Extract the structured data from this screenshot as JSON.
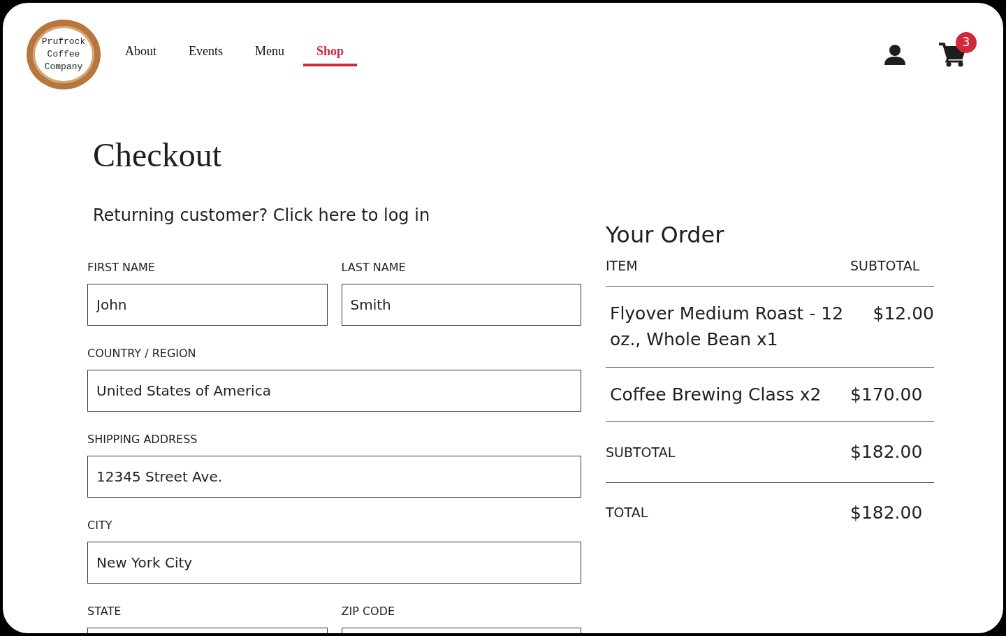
{
  "logo": {
    "lines": [
      "Prufrock",
      "Coffee",
      "Company"
    ]
  },
  "nav": [
    {
      "label": "About",
      "selected": false
    },
    {
      "label": "Events",
      "selected": false
    },
    {
      "label": "Menu",
      "selected": false
    },
    {
      "label": "Shop",
      "selected": true
    }
  ],
  "cart": {
    "count": "3"
  },
  "page_title": "Checkout",
  "login_prompt": "Returning customer? Click here to log in",
  "form": {
    "rows": [
      [
        {
          "label": "FIRST NAME",
          "value": "John"
        },
        {
          "label": "LAST NAME",
          "value": "Smith"
        }
      ],
      [
        {
          "label": "COUNTRY / REGION",
          "value": "United States of America"
        }
      ],
      [
        {
          "label": "SHIPPING ADDRESS",
          "value": "12345 Street Ave."
        }
      ],
      [
        {
          "label": "CITY",
          "value": "New York City"
        }
      ],
      [
        {
          "label": "STATE"
        },
        {
          "label": "ZIP CODE"
        }
      ]
    ]
  },
  "order": {
    "title": "Your Order",
    "columns": [
      "ITEM",
      "SUBTOTAL"
    ],
    "items": [
      {
        "name": "Flyover Medium Roast - 12 oz., Whole Bean x1",
        "price": "$12.00"
      },
      {
        "name": "Coffee Brewing Class x2",
        "price": "$170.00"
      }
    ],
    "totals": [
      {
        "label": "SUBTOTAL",
        "value": "$182.00"
      },
      {
        "label": "TOTAL",
        "value": "$182.00"
      }
    ]
  }
}
